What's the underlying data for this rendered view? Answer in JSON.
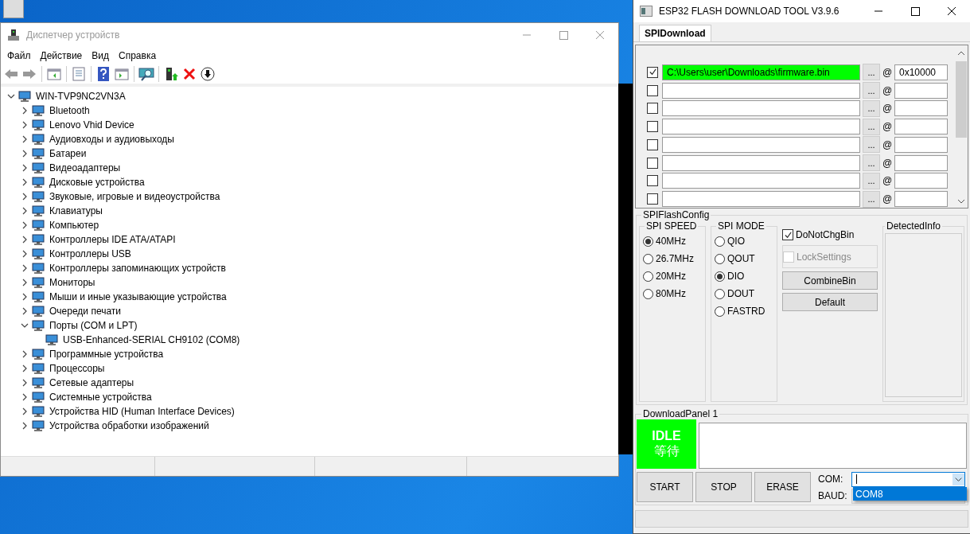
{
  "device_manager": {
    "title": "Диспетчер устройств",
    "menu": [
      "Файл",
      "Действие",
      "Вид",
      "Справка"
    ],
    "tree": {
      "label": "WIN-TVP9NC2VN3A",
      "expanded": true,
      "children": [
        {
          "label": "Bluetooth",
          "expanded": false
        },
        {
          "label": "Lenovo Vhid Device",
          "expanded": false
        },
        {
          "label": "Аудиовходы и аудиовыходы",
          "expanded": false
        },
        {
          "label": "Батареи",
          "expanded": false
        },
        {
          "label": "Видеоадаптеры",
          "expanded": false
        },
        {
          "label": "Дисковые устройства",
          "expanded": false
        },
        {
          "label": "Звуковые, игровые и видеоустройства",
          "expanded": false
        },
        {
          "label": "Клавиатуры",
          "expanded": false
        },
        {
          "label": "Компьютер",
          "expanded": false
        },
        {
          "label": "Контроллеры IDE ATA/ATAPI",
          "expanded": false
        },
        {
          "label": "Контроллеры USB",
          "expanded": false
        },
        {
          "label": "Контроллеры запоминающих устройств",
          "expanded": false
        },
        {
          "label": "Мониторы",
          "expanded": false
        },
        {
          "label": "Мыши и иные указывающие устройства",
          "expanded": false
        },
        {
          "label": "Очереди печати",
          "expanded": false
        },
        {
          "label": "Порты (COM и LPT)",
          "expanded": true,
          "children": [
            {
              "label": "USB-Enhanced-SERIAL CH9102 (COM8)"
            }
          ]
        },
        {
          "label": "Программные устройства",
          "expanded": false
        },
        {
          "label": "Процессоры",
          "expanded": false
        },
        {
          "label": "Сетевые адаптеры",
          "expanded": false
        },
        {
          "label": "Системные устройства",
          "expanded": false
        },
        {
          "label": "Устройства HID (Human Interface Devices)",
          "expanded": false
        },
        {
          "label": "Устройства обработки изображений",
          "expanded": false
        }
      ]
    }
  },
  "flash_tool": {
    "title": "ESP32 FLASH DOWNLOAD TOOL V3.9.6",
    "tabs": [
      {
        "label": "SPIDownload",
        "selected": true
      }
    ],
    "file_rows": [
      {
        "checked": true,
        "path": "C:\\Users\\user\\Downloads\\firmware.bin",
        "browse": "...",
        "at": "@",
        "address": "0x10000"
      },
      {
        "checked": false,
        "path": "",
        "browse": "...",
        "at": "@",
        "address": ""
      },
      {
        "checked": false,
        "path": "",
        "browse": "...",
        "at": "@",
        "address": ""
      },
      {
        "checked": false,
        "path": "",
        "browse": "...",
        "at": "@",
        "address": ""
      },
      {
        "checked": false,
        "path": "",
        "browse": "...",
        "at": "@",
        "address": ""
      },
      {
        "checked": false,
        "path": "",
        "browse": "...",
        "at": "@",
        "address": ""
      },
      {
        "checked": false,
        "path": "",
        "browse": "...",
        "at": "@",
        "address": ""
      },
      {
        "checked": false,
        "path": "",
        "browse": "...",
        "at": "@",
        "address": ""
      }
    ],
    "flash_config": {
      "title": "SPIFlashConfig",
      "spi_speed": {
        "title": "SPI SPEED",
        "options": [
          {
            "label": "40MHz",
            "selected": true
          },
          {
            "label": "26.7MHz",
            "selected": false
          },
          {
            "label": "20MHz",
            "selected": false
          },
          {
            "label": "80MHz",
            "selected": false
          }
        ]
      },
      "spi_mode": {
        "title": "SPI MODE",
        "options": [
          {
            "label": "QIO",
            "selected": false
          },
          {
            "label": "QOUT",
            "selected": false
          },
          {
            "label": "DIO",
            "selected": true
          },
          {
            "label": "DOUT",
            "selected": false
          },
          {
            "label": "FASTRD",
            "selected": false
          }
        ]
      },
      "do_not_chg_bin": {
        "label": "DoNotChgBin",
        "checked": true
      },
      "lock_settings": {
        "label": "LockSettings",
        "checked": false,
        "disabled": true
      },
      "buttons": [
        "CombineBin",
        "Default"
      ],
      "detected_info": {
        "title": "DetectedInfo"
      }
    },
    "download_panel": {
      "title": "DownloadPanel 1",
      "status": {
        "label": "IDLE",
        "sublabel": "等待"
      },
      "buttons": [
        "START",
        "STOP",
        "ERASE"
      ],
      "com": {
        "label": "COM:",
        "expanded": true,
        "options": [
          {
            "label": "COM8",
            "selected": true
          }
        ]
      },
      "baud": {
        "label": "BAUD:"
      }
    }
  }
}
